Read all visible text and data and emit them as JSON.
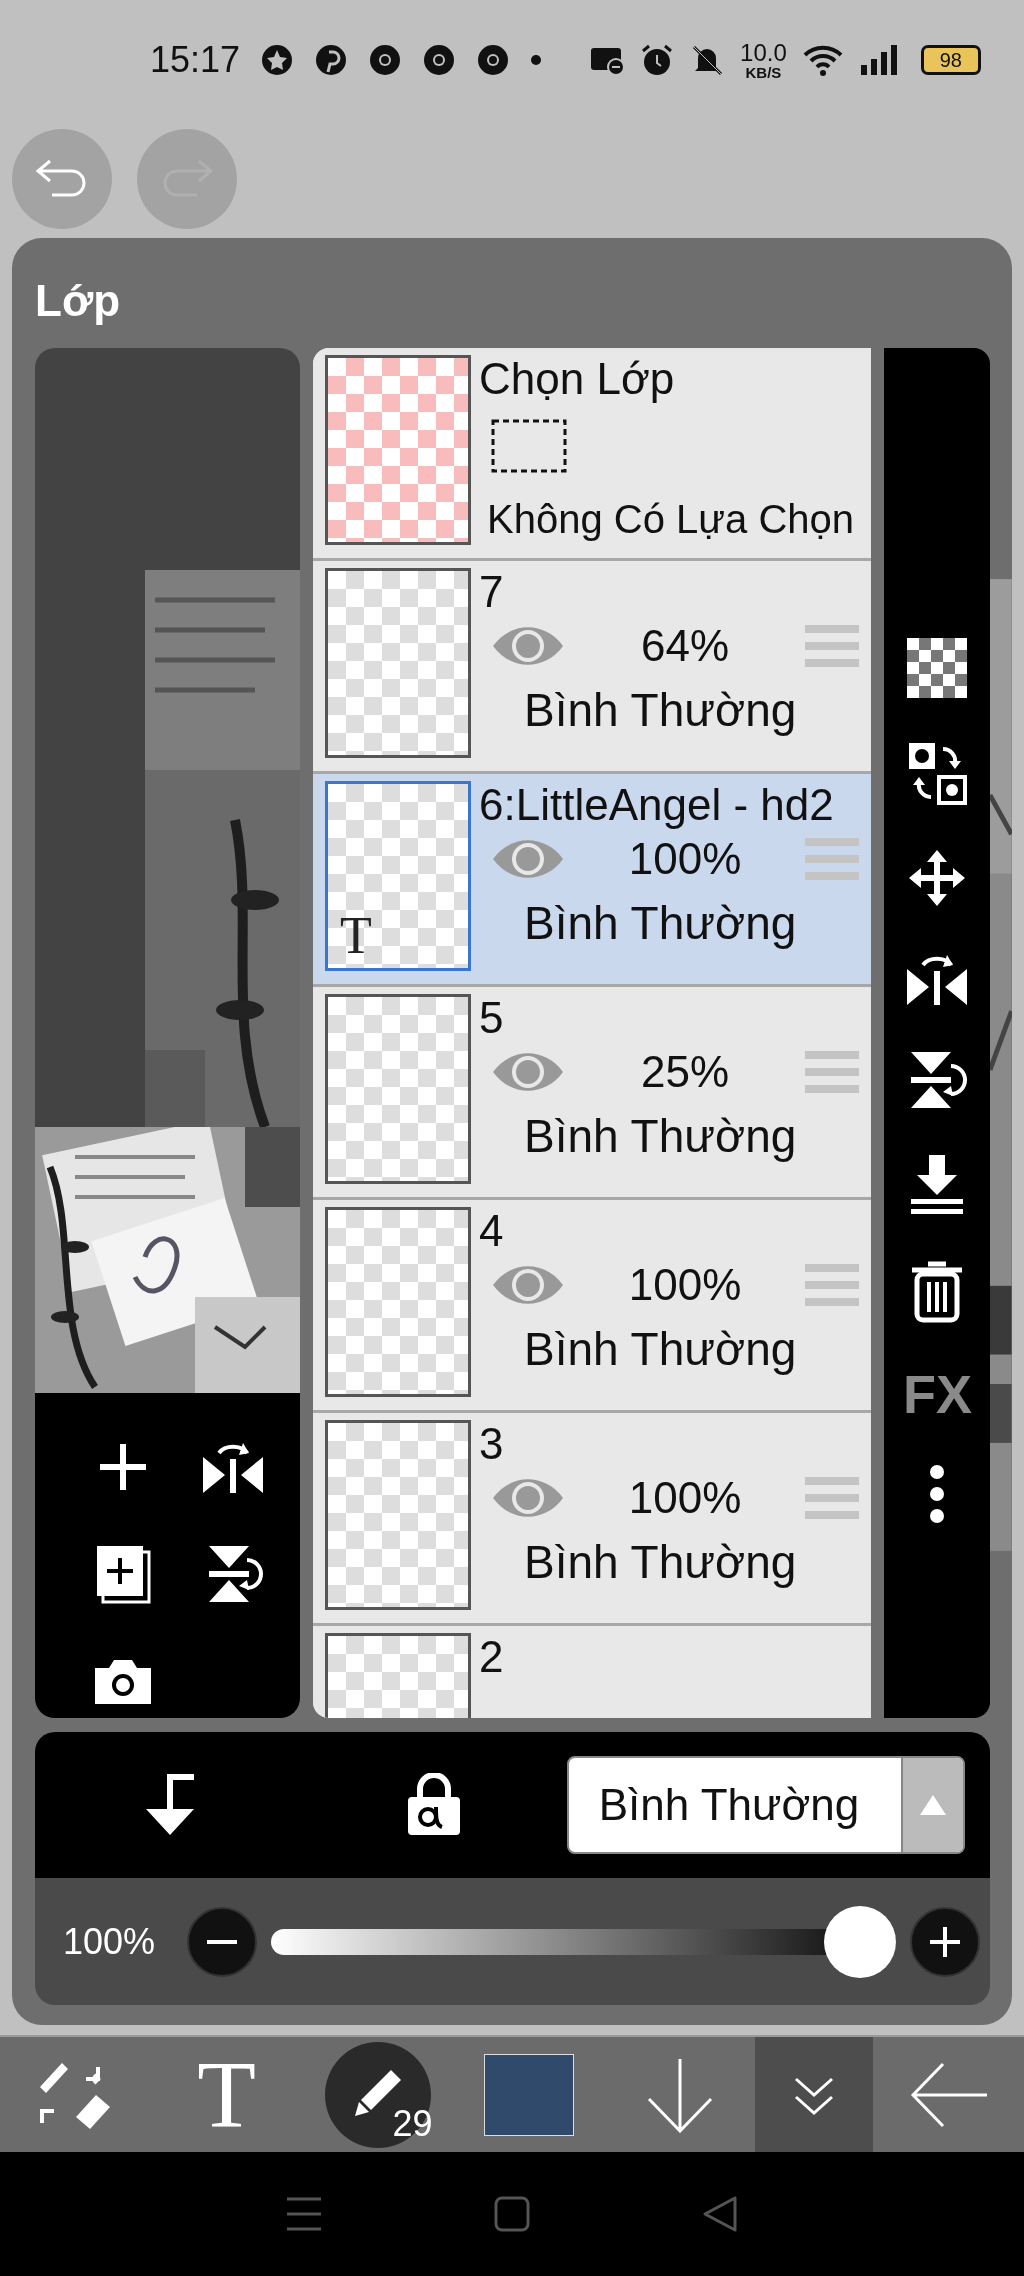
{
  "status_bar": {
    "time": "15:17",
    "network_speed": "10.0",
    "network_unit": "KB/S",
    "battery": "98"
  },
  "panel": {
    "title": "Lớp"
  },
  "selection_layer": {
    "title": "Chọn Lớp",
    "status": "Không Có Lựa Chọn"
  },
  "layers": [
    {
      "name": "7",
      "opacity": "64%",
      "blend": "Bình Thường",
      "selected": false,
      "kind": "raster"
    },
    {
      "name": "6:LittleAngel - hd2",
      "opacity": "100%",
      "blend": "Bình Thường",
      "selected": true,
      "kind": "text",
      "type_mark": "T"
    },
    {
      "name": "5",
      "opacity": "25%",
      "blend": "Bình Thường",
      "selected": false,
      "kind": "raster"
    },
    {
      "name": "4",
      "opacity": "100%",
      "blend": "Bình Thường",
      "selected": false,
      "kind": "raster"
    },
    {
      "name": "3",
      "opacity": "100%",
      "blend": "Bình Thường",
      "selected": false,
      "kind": "raster"
    },
    {
      "name": "2",
      "selected": false,
      "kind": "raster"
    }
  ],
  "side_tools": {
    "fx_label": "FX"
  },
  "blend_mode": {
    "value": "Bình Thường"
  },
  "opacity": {
    "reading": "100%",
    "level": 1
  },
  "toolbar": {
    "text_tool": "T",
    "brush_size": "29",
    "color": "#2f4a6b"
  }
}
